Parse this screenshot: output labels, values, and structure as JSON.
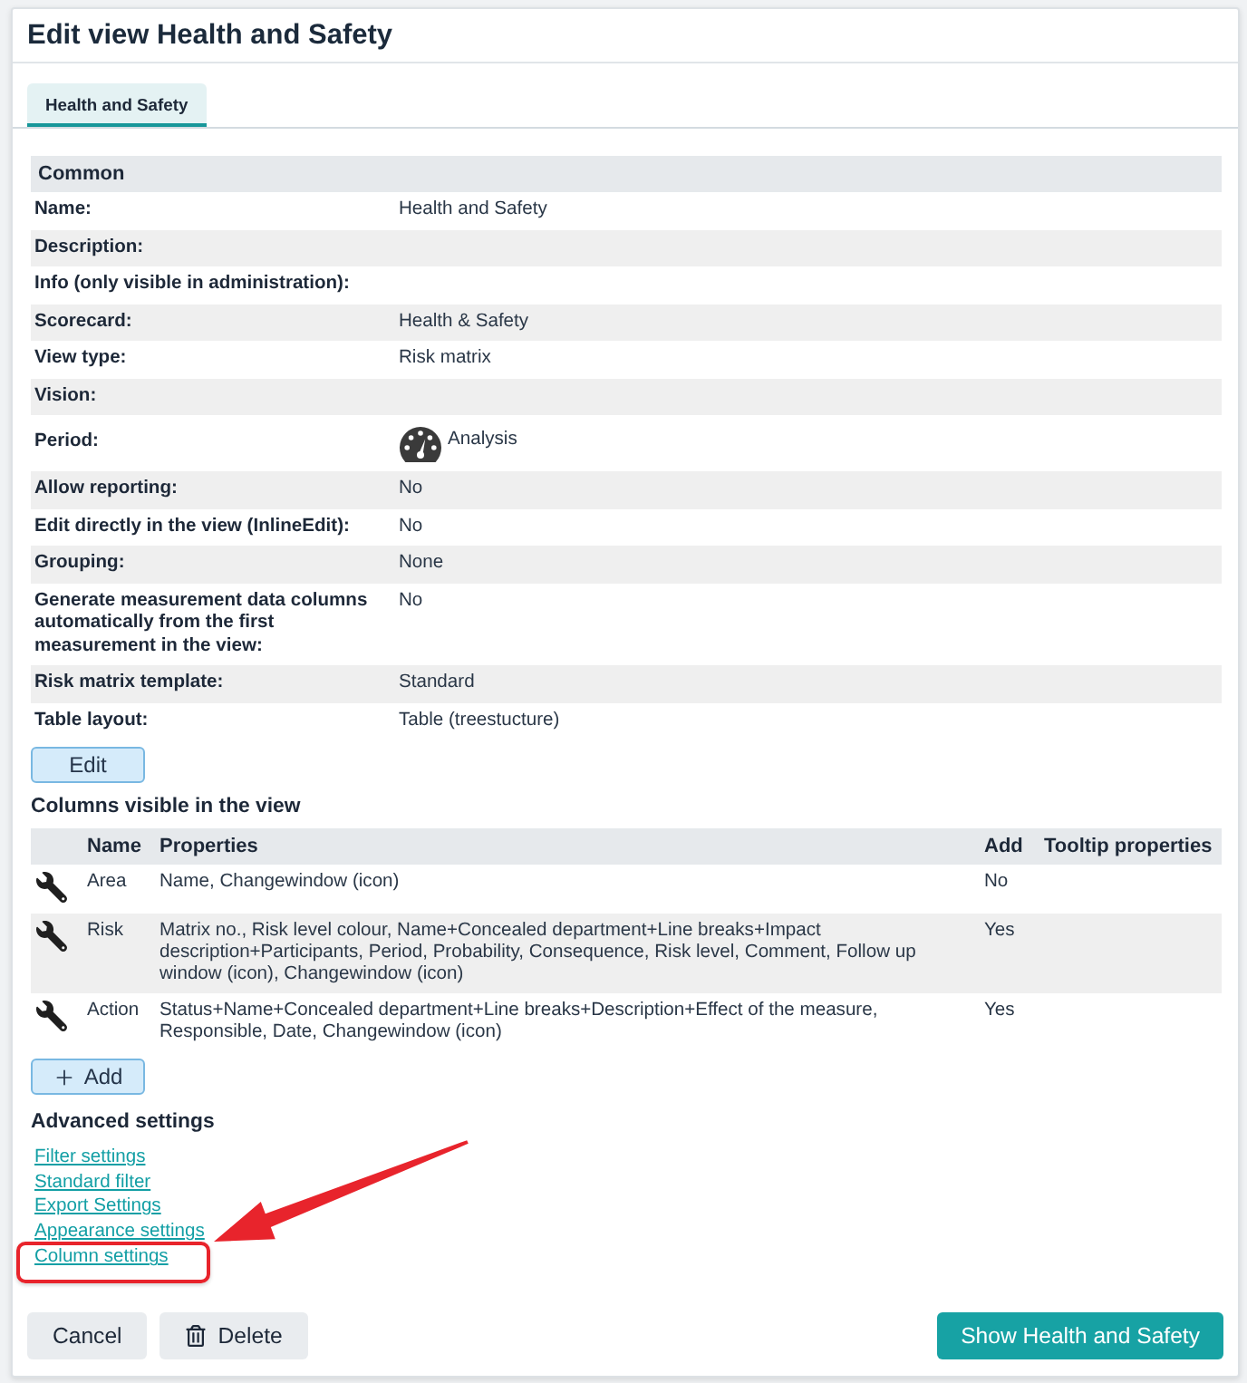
{
  "dialog": {
    "title": "Edit view Health and Safety"
  },
  "tabs": [
    {
      "label": "Health and Safety",
      "selected": true
    }
  ],
  "common": {
    "heading": "Common",
    "rows": [
      {
        "kind": "text",
        "label": "Name:",
        "value": "Health and Safety"
      },
      {
        "kind": "text",
        "label": "Description:"
      },
      {
        "kind": "text",
        "label": "Info (only visible in administration):"
      },
      {
        "kind": "text",
        "label": "Scorecard:",
        "value": "Health & Safety"
      },
      {
        "kind": "text",
        "label": "View type:",
        "value": "Risk matrix"
      },
      {
        "kind": "text",
        "label": "Vision:"
      },
      {
        "kind": "with_icon",
        "label": "Period:",
        "value": "Analysis"
      },
      {
        "kind": "text",
        "label": "Allow reporting:",
        "value": "No"
      },
      {
        "kind": "text",
        "label": "Edit directly in the view (InlineEdit):",
        "value": "No"
      },
      {
        "kind": "text",
        "label": "Grouping:",
        "value": "None"
      },
      {
        "kind": "text",
        "label": "Generate measurement data columns automatically from the first measurement in the view:",
        "value": "No"
      },
      {
        "kind": "text",
        "label": "Risk matrix template:",
        "value": "Standard"
      },
      {
        "kind": "text",
        "label": "Table layout:",
        "value": "Table (treestucture)"
      }
    ]
  },
  "edit_button": {
    "label": "Edit"
  },
  "visible_columns": {
    "heading": "Columns visible in the view",
    "columns": [
      "Name",
      "Properties",
      "Add",
      "Tooltip properties"
    ],
    "rows": [
      {
        "name": "Area",
        "properties": "Name, Changewindow (icon)",
        "add": "No"
      },
      {
        "name": "Risk",
        "properties": "Matrix no., Risk level colour, Name+Concealed department+Line breaks+Impact description+Participants, Period, Probability, Consequence, Risk level, Comment, Follow up window (icon), Changewindow (icon)",
        "add": "Yes"
      },
      {
        "name": "Action",
        "properties": "Status+Name+Concealed department+Line breaks+Description+Effect of the measure, Responsible, Date, Changewindow (icon)",
        "add": "Yes"
      }
    ]
  },
  "add_button": {
    "label": "Add"
  },
  "advanced_settings": {
    "heading": "Advanced settings",
    "links": [
      {
        "label": "Filter settings",
        "highlighted": false
      },
      {
        "label": "Standard filter",
        "highlighted": false
      },
      {
        "label": "Export Settings",
        "highlighted": false
      },
      {
        "label": "Appearance settings",
        "highlighted": false
      },
      {
        "label": "Column settings",
        "highlighted": true
      }
    ]
  },
  "footer": {
    "buttons": [
      {
        "kind": "secondary",
        "label": "Cancel"
      },
      {
        "kind": "delete",
        "label": "Delete"
      },
      {
        "kind": "primary",
        "label": "Show Health and Safety"
      }
    ]
  }
}
